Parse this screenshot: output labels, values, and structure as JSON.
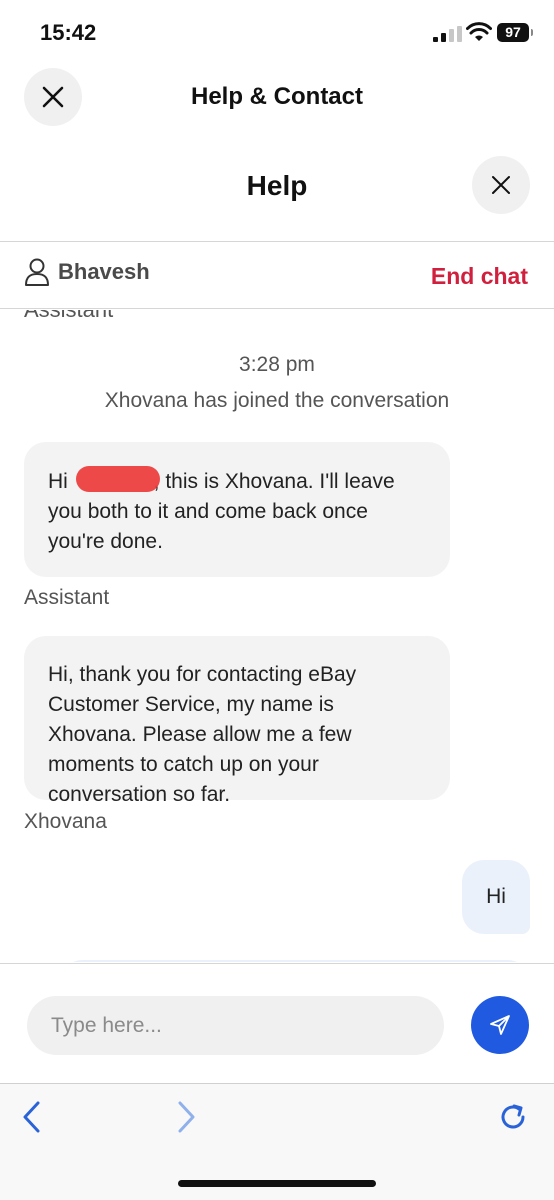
{
  "status_bar": {
    "time": "15:42",
    "battery": "97"
  },
  "nav": {
    "title": "Help & Contact"
  },
  "help": {
    "title": "Help"
  },
  "chat_bar": {
    "user_name": "Bhavesh",
    "end_chat": "End chat"
  },
  "chat": {
    "cut_label": "Assistant",
    "timestamp": "3:28 pm",
    "joined": "Xhovana has joined the conversation",
    "messages": [
      {
        "prefix": "Hi ",
        "text": ", this is Xhovana. I'll leave you both to it and come back once you're done.",
        "sender": "Assistant"
      },
      {
        "text": "Hi, thank you for contacting eBay Customer Service, my name is Xhovana. Please allow me a few moments to catch up on your conversation so far.",
        "sender": "Xhovana"
      }
    ],
    "user_message": "Hi"
  },
  "composer": {
    "placeholder": "Type here..."
  },
  "icons": {
    "close": "close-icon",
    "user": "user-icon",
    "send": "send-icon",
    "back": "back-arrow-icon",
    "forward": "forward-arrow-icon",
    "refresh": "refresh-icon"
  },
  "colors": {
    "accent": "#1f5ae0",
    "end_chat": "#d0203d",
    "user_bubble": "#eaf1fb",
    "agent_bubble": "#f3f3f3"
  }
}
